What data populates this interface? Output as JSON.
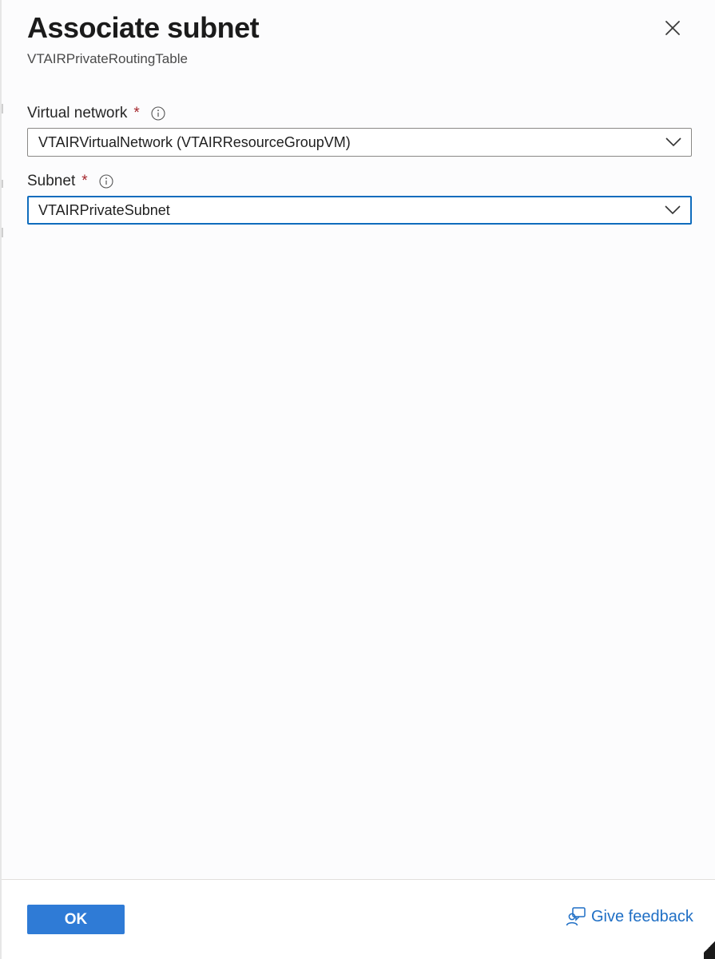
{
  "panel": {
    "title": "Associate subnet",
    "subtitle": "VTAIRPrivateRoutingTable",
    "close_icon": "close-icon"
  },
  "fields": {
    "virtual_network": {
      "label": "Virtual network",
      "required_marker": "*",
      "info_icon": "info-icon",
      "value": "VTAIRVirtualNetwork (VTAIRResourceGroupVM)"
    },
    "subnet": {
      "label": "Subnet",
      "required_marker": "*",
      "info_icon": "info-icon",
      "value": "VTAIRPrivateSubnet"
    }
  },
  "footer": {
    "ok_label": "OK",
    "feedback_label": "Give feedback",
    "feedback_icon": "feedback-icon"
  },
  "colors": {
    "accent": "#2f7bd6",
    "focus_border": "#0f6cbd",
    "required": "#a4262c",
    "link": "#1f6fc5"
  }
}
